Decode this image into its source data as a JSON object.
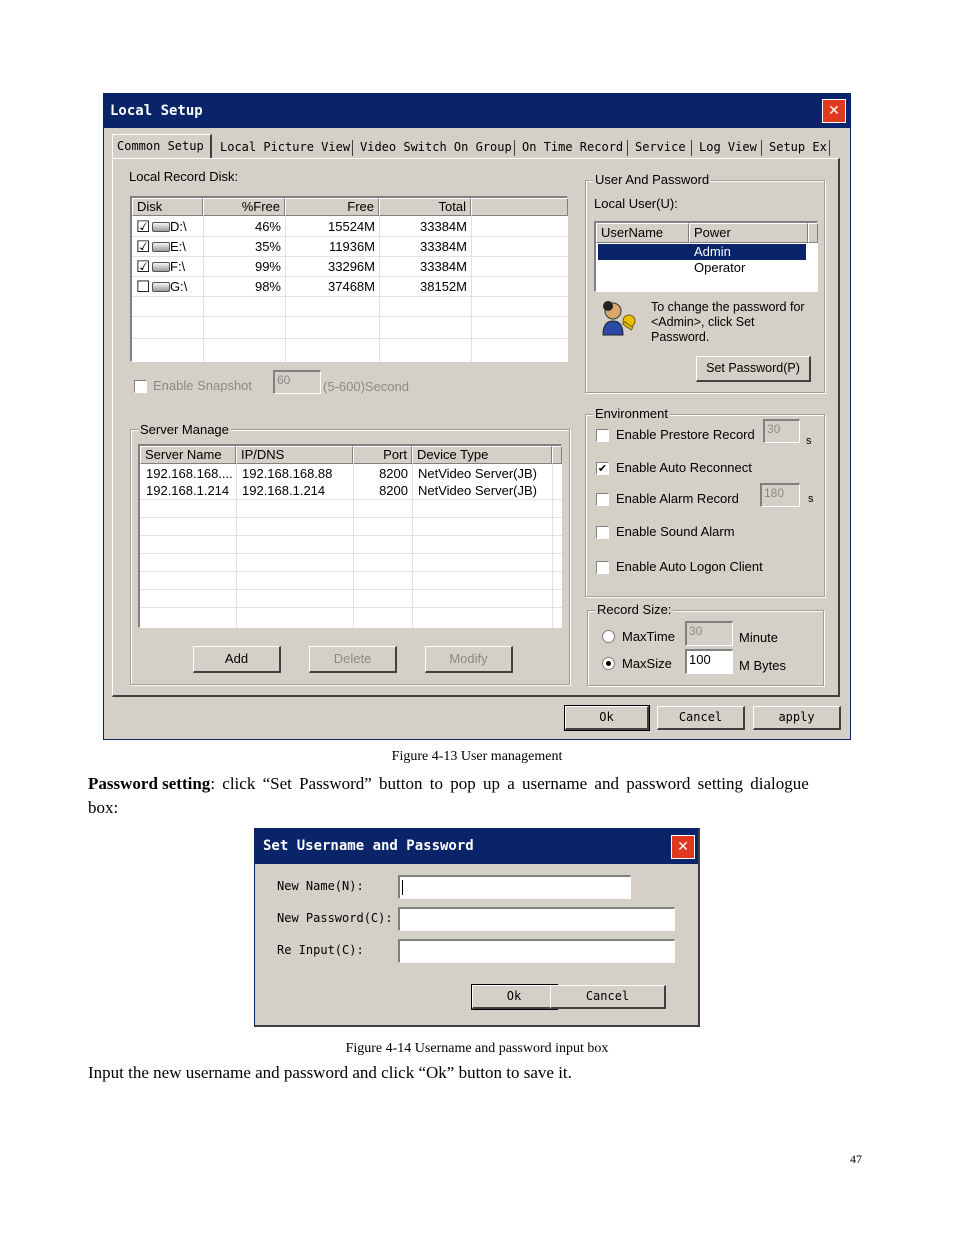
{
  "local_setup": {
    "title": "Local Setup",
    "close": "✕",
    "tabs": [
      "Common Setup",
      "Local Picture View",
      "Video Switch On Group",
      "On Time Record",
      "Service",
      "Log View",
      "Setup Ex"
    ],
    "record_disk": {
      "label": "Local Record Disk:",
      "headers": [
        "Disk",
        "%Free",
        "Free",
        "Total"
      ],
      "rows": [
        {
          "checked": "☑",
          "disk": "D:\\",
          "pct": "46%",
          "free": "15524M",
          "total": "33384M"
        },
        {
          "checked": "☑",
          "disk": "E:\\",
          "pct": "35%",
          "free": "11936M",
          "total": "33384M"
        },
        {
          "checked": "☑",
          "disk": "F:\\",
          "pct": "99%",
          "free": "33296M",
          "total": "33384M"
        },
        {
          "checked": "☐",
          "disk": "G:\\",
          "pct": "98%",
          "free": "37468M",
          "total": "38152M"
        }
      ]
    },
    "snapshot": {
      "label": "Enable Snapshot",
      "value": "60",
      "range": "(5-600)Second"
    },
    "server_manage": {
      "label": "Server Manage",
      "headers": [
        "Server Name",
        "IP/DNS",
        "Port",
        "Device Type"
      ],
      "rows": [
        {
          "name": "192.168.168....",
          "ip": "192.168.168.88",
          "port": "8200",
          "type": "NetVideo Server(JB)"
        },
        {
          "name": "192.168.1.214",
          "ip": "192.168.1.214",
          "port": "8200",
          "type": "NetVideo Server(JB)"
        }
      ],
      "add": "Add",
      "delete": "Delete",
      "modify": "Modify"
    },
    "user_password": {
      "label": "User And Password",
      "local_user": "Local User(U):",
      "headers": [
        "UserName",
        "Power"
      ],
      "rows": [
        {
          "name": "",
          "power": "Admin"
        },
        {
          "name": "",
          "power": "Operator"
        }
      ],
      "hint": [
        "To change the password for",
        "<Admin>, click Set",
        "Password."
      ],
      "set_password": "Set Password(P)"
    },
    "environment": {
      "label": "Environment",
      "prestore": {
        "label": "Enable Prestore Record",
        "value": "30",
        "unit": "s"
      },
      "auto_reconnect": {
        "label": "Enable Auto Reconnect",
        "check": "✔"
      },
      "alarm_record": {
        "label": "Enable Alarm Record",
        "value": "180",
        "unit": "s"
      },
      "sound_alarm": "Enable Sound Alarm",
      "auto_logon": "Enable Auto Logon Client"
    },
    "record_size": {
      "label": "Record Size:",
      "maxtime": {
        "label": "MaxTime",
        "value": "30",
        "unit": "Minute"
      },
      "maxsize": {
        "label": "MaxSize",
        "value": "100",
        "unit": "M Bytes"
      }
    },
    "ok": "Ok",
    "cancel": "Cancel",
    "apply": "apply"
  },
  "caption1": "Figure 4-13 User management",
  "para1_bold": "Password setting",
  "para1_rest": ": click “Set Password” button to pop up a username and password setting dialogue",
  "para1_line2": "box:",
  "set_user_dialog": {
    "title": "Set Username and Password",
    "close": "✕",
    "new_name": "New Name(N):",
    "new_password": "New Password(C):",
    "re_input": "Re Input(C):",
    "ok": "Ok",
    "cancel": "Cancel"
  },
  "caption2": "Figure 4-14 Username and password input box",
  "para2": "Input the new username and password and click “Ok” button to save it.",
  "page_number": "47"
}
